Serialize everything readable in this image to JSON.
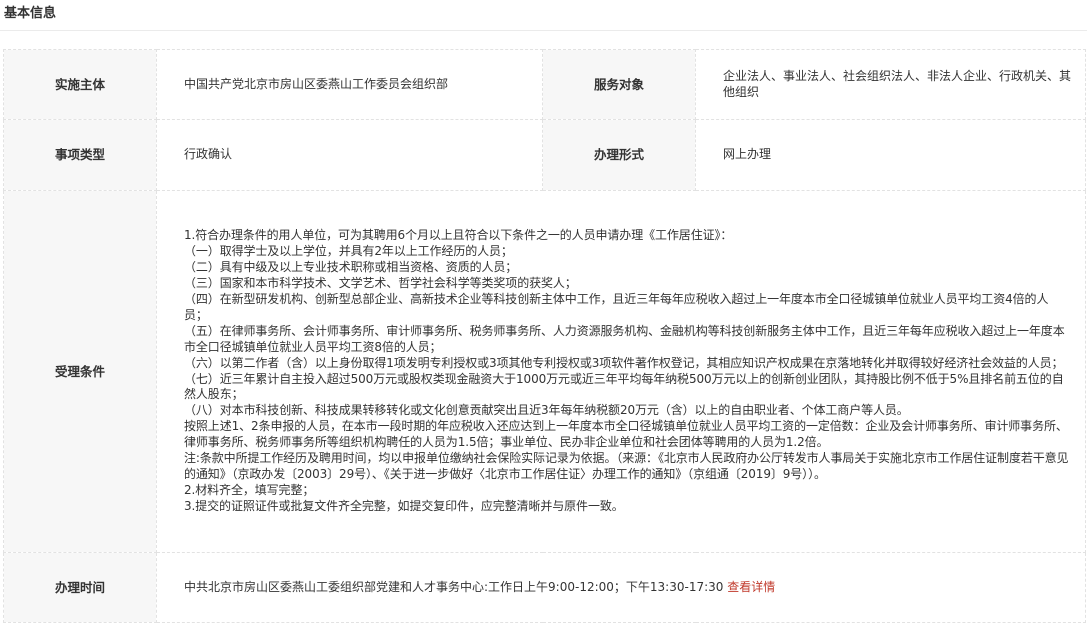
{
  "section_title": "基本信息",
  "rows": {
    "implementer_label": "实施主体",
    "implementer_value": "中国共产党北京市房山区委燕山工作委员会组织部",
    "service_target_label": "服务对象",
    "service_target_value": "企业法人、事业法人、社会组织法人、非法人企业、行政机关、其他组织",
    "item_type_label": "事项类型",
    "item_type_value": "行政确认",
    "handling_form_label": "办理形式",
    "handling_form_value": "网上办理",
    "conditions_label": "受理条件",
    "conditions_lines": [
      "1.符合办理条件的用人单位，可为其聘用6个月以上且符合以下条件之一的人员申请办理《工作居住证》：",
      "（一）取得学士及以上学位，并具有2年以上工作经历的人员；",
      "（二）具有中级及以上专业技术职称或相当资格、资质的人员；",
      "（三）国家和本市科学技术、文学艺术、哲学社会科学等类奖项的获奖人；",
      "（四）在新型研发机构、创新型总部企业、高新技术企业等科技创新主体中工作，且近三年每年应税收入超过上一年度本市全口径城镇单位就业人员平均工资4倍的人员；",
      "（五）在律师事务所、会计师事务所、审计师事务所、税务师事务所、人力资源服务机构、金融机构等科技创新服务主体中工作，且近三年每年应税收入超过上一年度本市全口径城镇单位就业人员平均工资8倍的人员；",
      "（六）以第二作者（含）以上身份取得1项发明专利授权或3项其他专利授权或3项软件著作权登记，其相应知识产权成果在京落地转化并取得较好经济社会效益的人员；",
      "（七）近三年累计自主投入超过500万元或股权类现金融资大于1000万元或近三年平均每年纳税500万元以上的创新创业团队，其持股比例不低于5%且排名前五位的自然人股东；",
      "（八）对本市科技创新、科技成果转移转化或文化创意贡献突出且近3年每年纳税额20万元（含）以上的自由职业者、个体工商户等人员。",
      "按照上述1、2条申报的人员，在本市一段时期的年应税收入还应达到上一年度本市全口径城镇单位就业人员平均工资的一定倍数：企业及会计师事务所、审计师事务所、律师事务所、税务师事务所等组织机构聘任的人员为1.5倍；事业单位、民办非企业单位和社会团体等聘用的人员为1.2倍。",
      "注:条款中所提工作经历及聘用时间，均以申报单位缴纳社会保险实际记录为依据。（来源：《北京市人民政府办公厅转发市人事局关于实施北京市工作居住证制度若干意见的通知》（京政办发〔2003〕29号）、《关于进一步做好〈北京市工作居住证〉办理工作的通知》（京组通〔2019〕9号））。",
      "2.材料齐全，填写完整；",
      "3.提交的证照证件或批复文件齐全完整，如提交复印件，应完整清晰并与原件一致。"
    ],
    "handling_time_label": "办理时间",
    "handling_time_value": "中共北京市房山区委燕山工委组织部党建和人才事务中心:工作日上午9:00-12:00；下午13:30-17:30",
    "view_details_link": "查看详情"
  },
  "colors": {
    "label_bg": "#f7f7f7",
    "border": "#e2e2e2",
    "text": "#333333",
    "link": "#c0392b"
  }
}
